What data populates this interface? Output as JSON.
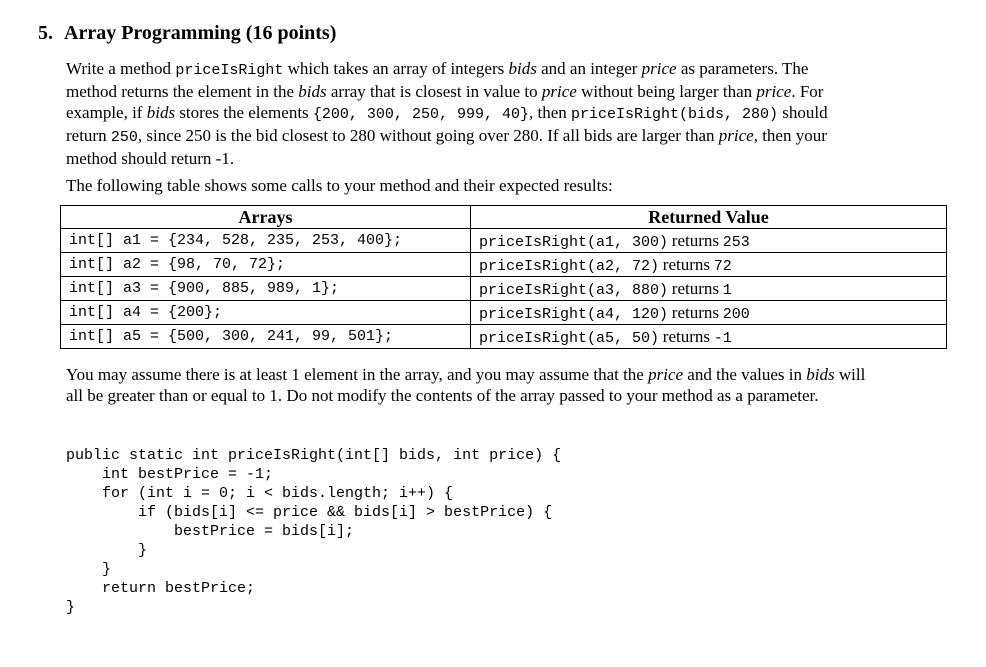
{
  "heading": {
    "number": "5.",
    "title": "Array Programming (16 points)"
  },
  "intro": {
    "l1_a": "Write a method ",
    "l1_code": "priceIsRight",
    "l1_b": " which takes an array of integers ",
    "l1_bids": "bids",
    "l1_c": " and an integer ",
    "l1_price": "price",
    "l1_d": " as parameters. The",
    "l2_a": "method returns the element in the ",
    "l2_bids": "bids",
    "l2_b": " array that is closest in value to ",
    "l2_price": "price",
    "l2_c": " without being larger than ",
    "l2_price2": "price",
    "l2_d": ". For",
    "l3_a": "example, if ",
    "l3_bids": "bids",
    "l3_b": " stores the elements ",
    "l3_code1": "{200, 300, 250, 999, 40}",
    "l3_c": ", then ",
    "l3_code2": "priceIsRight(bids, 280)",
    "l3_d": " should",
    "l4_a": "return ",
    "l4_code": "250",
    "l4_b": ", since 250 is the bid closest to 280 without going over 280. If all bids are larger than ",
    "l4_price": "price",
    "l4_c": ", then your",
    "l5": "method should return -1."
  },
  "table_intro": "The following table shows some calls to your method and their expected results:",
  "table": {
    "headers": [
      "Arrays",
      "Returned Value"
    ],
    "returns_word": "returns",
    "rows": [
      {
        "array": "int[] a1 = {234, 528, 235, 253, 400};",
        "call": "priceIsRight(a1, 300)",
        "value": "253"
      },
      {
        "array": "int[] a2 = {98, 70, 72};",
        "call": "priceIsRight(a2, 72)",
        "value": "72"
      },
      {
        "array": "int[] a3 = {900, 885, 989, 1};",
        "call": "priceIsRight(a3, 880)",
        "value": "1"
      },
      {
        "array": "int[] a4 = {200};",
        "call": "priceIsRight(a4, 120)",
        "value": "200"
      },
      {
        "array": "int[] a5 = {500, 300, 241, 99, 501};",
        "call": "priceIsRight(a5, 50)",
        "value": "-1"
      }
    ]
  },
  "assumption": {
    "l1_a": "You may assume there is at least 1 element in the array, and you may assume that the ",
    "l1_price": "price",
    "l1_b": " and the values in ",
    "l1_bids": "bids",
    "l1_c": " will",
    "l2": "all be greater than or equal to 1. Do not modify the contents of the array passed to your method as a parameter."
  },
  "code_lines": [
    "public static int priceIsRight(int[] bids, int price) {",
    "    int bestPrice = -1;",
    "    for (int i = 0; i < bids.length; i++) {",
    "        if (bids[i] <= price && bids[i] > bestPrice) {",
    "            bestPrice = bids[i];",
    "        }",
    "    }",
    "    return bestPrice;",
    "}"
  ]
}
